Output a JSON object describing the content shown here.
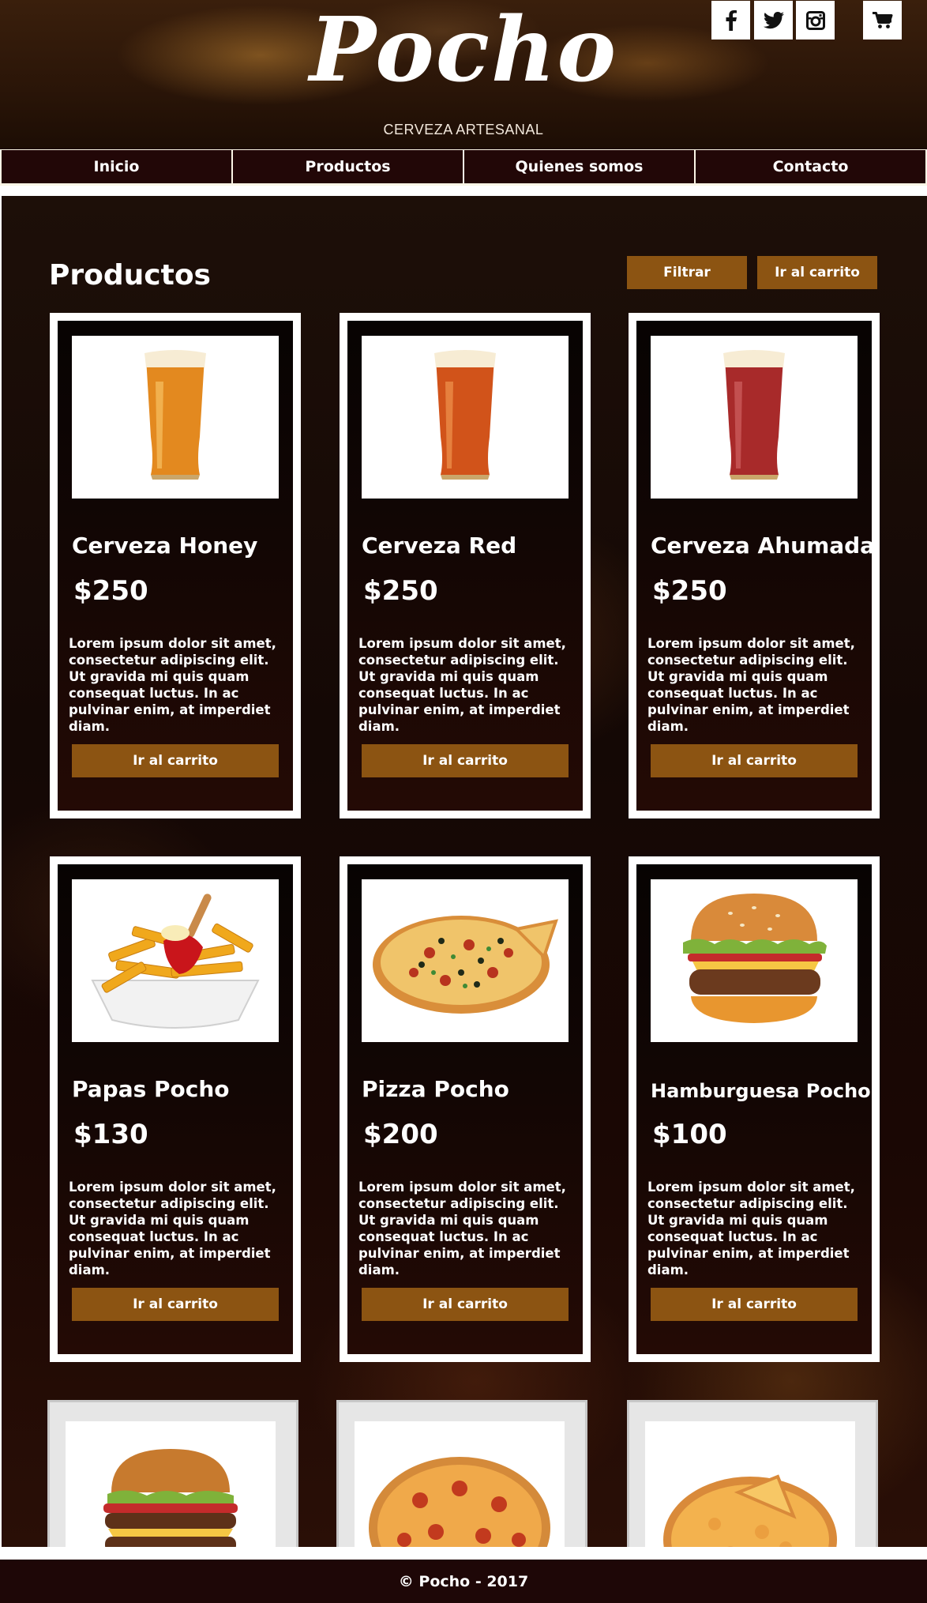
{
  "header": {
    "logo": "Pocho",
    "tagline": "CERVEZA ARTESANAL",
    "social_icons": [
      "facebook-icon",
      "twitter-icon",
      "instagram-icon"
    ],
    "cart_icon": "shopping-cart-icon"
  },
  "nav": {
    "items": [
      {
        "label": "Inicio"
      },
      {
        "label": "Productos"
      },
      {
        "label": "Quienes somos"
      },
      {
        "label": "Contacto"
      }
    ]
  },
  "products_section": {
    "title": "Productos",
    "filter_button": "Filtrar",
    "cart_button": "Ir al carrito"
  },
  "products": [
    {
      "name": "Cerveza Honey",
      "price": "$250",
      "description": "Lorem ipsum dolor sit amet, consectetur adipiscing elit. Ut gravida mi quis quam consequat luctus. In ac pulvinar enim, at imperdiet diam.",
      "button": "Ir al carrito",
      "image": "beer-honey-image"
    },
    {
      "name": "Cerveza Red",
      "price": "$250",
      "description": "Lorem ipsum dolor sit amet, consectetur adipiscing elit. Ut gravida mi quis quam consequat luctus. In ac pulvinar enim, at imperdiet diam.",
      "button": "Ir al carrito",
      "image": "beer-red-image"
    },
    {
      "name": "Cerveza Ahumada",
      "price": "$250",
      "description": "Lorem ipsum dolor sit amet, consectetur adipiscing elit. Ut gravida mi quis quam consequat luctus. In ac pulvinar enim, at imperdiet diam.",
      "button": "Ir al carrito",
      "image": "beer-smoked-image"
    },
    {
      "name": "Papas Pocho",
      "price": "$130",
      "description": "Lorem ipsum dolor sit amet, consectetur adipiscing elit. Ut gravida mi quis quam consequat luctus. In ac pulvinar enim, at imperdiet diam.",
      "button": "Ir al carrito",
      "image": "fries-image"
    },
    {
      "name": "Pizza Pocho",
      "price": "$200",
      "description": "Lorem ipsum dolor sit amet, consectetur adipiscing elit. Ut gravida mi quis quam consequat luctus. In ac pulvinar enim, at imperdiet diam.",
      "button": "Ir al carrito",
      "image": "pizza-image"
    },
    {
      "name": "Hamburguesa Pocho",
      "price": "$100",
      "description": "Lorem ipsum dolor sit amet, consectetur adipiscing elit. Ut gravida mi quis quam consequat luctus. In ac pulvinar enim, at imperdiet diam.",
      "button": "Ir al carrito",
      "image": "burger-image"
    }
  ],
  "partial_products": [
    {
      "image": "double-burger-image"
    },
    {
      "image": "pepperoni-pizza-image"
    },
    {
      "image": "cheese-pizza-image"
    }
  ],
  "colors": {
    "accent": "#8c5412",
    "nav_bg": "#220707",
    "footer_bg": "#1e0707"
  },
  "footer": {
    "text": "© Pocho - 2017"
  }
}
